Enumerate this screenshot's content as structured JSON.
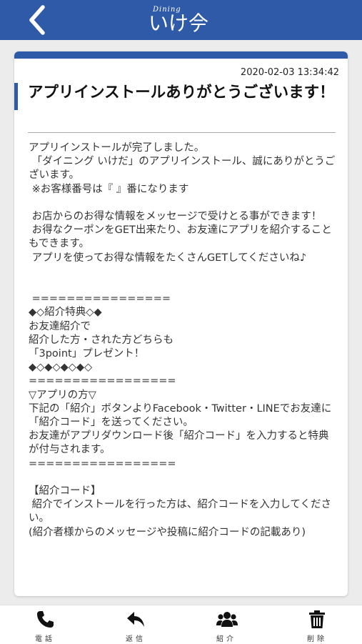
{
  "header": {
    "back_icon": "chevron-left-icon",
    "logo_small": "Dining",
    "logo_text": "いけ𫝆"
  },
  "message": {
    "timestamp": "2020-02-03 13:34:42",
    "title": "アプリインストールありがとうございます！",
    "body": "アプリインストールが完了しました。\n 「ダイニング いけだ」のアプリインストール、誠にありがとうございます。\n ※お客様番号は『 』番になります\n\n お店からのお得な情報をメッセージで受けとる事ができます！\n お得なクーポンをGET出来たり、お友達にアプリを紹介することもできます。\n アプリを使ってお得な情報をたくさんGETしてくださいね♪\n\n\n ================\n◆◇紹介特典◇◆\nお友達紹介で\n紹介した方・された方どちらも\n「3point」プレゼント！\n◆◇◆◇◆◇◆◇\n=================\n▽アプリの方▽\n下記の「紹介」ボタンよりFacebook・Twitter・LINEでお友達に「紹介コード」を送ってください。\nお友達がアプリダウンロード後「紹介コード」を入力すると特典が付与されます。\n=================\n\n【紹介コード】\n 紹介でインストールを行った方は、紹介コードを入力してください。\n(紹介者様からのメッセージや投稿に紹介コードの記載あり)"
  },
  "footer": {
    "call_label": "電話",
    "reply_label": "返信",
    "share_label": "紹介",
    "delete_label": "削除",
    "call_icon": "phone-icon",
    "reply_icon": "reply-icon",
    "share_icon": "users-icon",
    "delete_icon": "trash-icon"
  },
  "colors": {
    "brand": "#2e5aa8",
    "background": "#ececec"
  }
}
